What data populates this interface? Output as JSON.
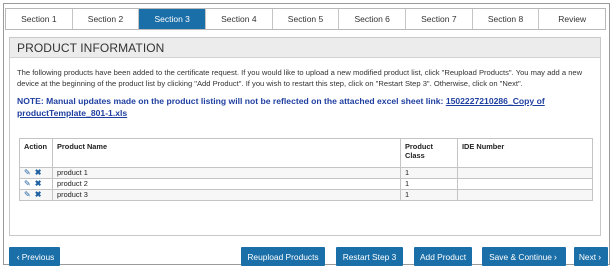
{
  "tabs": [
    "Section 1",
    "Section 2",
    "Section 3",
    "Section 4",
    "Section 5",
    "Section 6",
    "Section 7",
    "Section 8",
    "Review"
  ],
  "active_tab": "Section 3",
  "panel": {
    "title": "PRODUCT INFORMATION",
    "intro": "The following products have been added to the certificate request. If you would like to upload a new modified product list, click \"Reupload Products\". You may add a new device at the beginning of the product list by clicking \"Add Product\". If you wish to restart this step, click on \"Restart Step 3\". Otherwise, click on \"Next\".",
    "note_prefix": "NOTE: Manual updates made on the product listing will not be reflected on the attached excel sheet link:",
    "note_link": "1502227210286_Copy of productTemplate_801-1.xls"
  },
  "table": {
    "headers": {
      "action": "Action",
      "name": "Product Name",
      "class": "Product Class",
      "ide": "IDE Number"
    },
    "rows": [
      {
        "name": "product 1",
        "class": "1",
        "ide": ""
      },
      {
        "name": "product 2",
        "class": "1",
        "ide": ""
      },
      {
        "name": "product 3",
        "class": "1",
        "ide": ""
      }
    ]
  },
  "buttons": {
    "previous": "Previous",
    "reupload": "Reupload Products",
    "restart": "Restart Step 3",
    "add": "Add Product",
    "save": "Save & Continue",
    "next": "Next"
  },
  "icons": {
    "edit": "pencil-icon",
    "delete": "x-icon",
    "prev": "chevron-left-icon",
    "next": "chevron-right-icon"
  },
  "colors": {
    "accent": "#1b6fa8",
    "note": "#1f3fa0"
  }
}
